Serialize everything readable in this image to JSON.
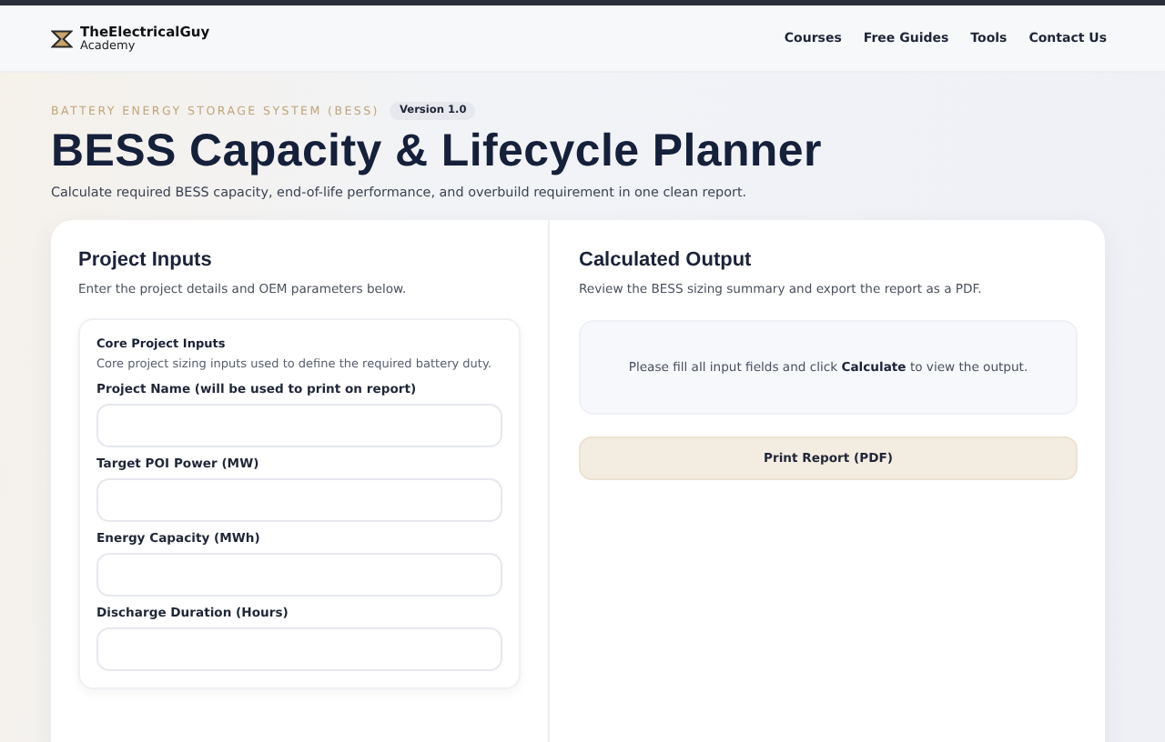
{
  "header": {
    "logo_name": "TheElectricalGuy",
    "logo_sub": "Academy",
    "nav": [
      "Courses",
      "Free Guides",
      "Tools",
      "Contact Us"
    ]
  },
  "hero": {
    "eyebrow": "BATTERY ENERGY STORAGE SYSTEM (BESS)",
    "version": "Version 1.0",
    "title": "BESS Capacity & Lifecycle Planner",
    "subtitle": "Calculate required BESS capacity, end-of-life performance, and overbuild requirement in one clean report."
  },
  "inputs": {
    "title": "Project Inputs",
    "description": "Enter the project details and OEM parameters below.",
    "section_title": "Core Project Inputs",
    "section_description": "Core project sizing inputs used to define the required battery duty.",
    "fields": [
      {
        "label": "Project Name (will be used to print on report)"
      },
      {
        "label": "Target POI Power (MW)"
      },
      {
        "label": "Energy Capacity (MWh)"
      },
      {
        "label": "Discharge Duration (Hours)"
      }
    ]
  },
  "output": {
    "title": "Calculated Output",
    "description": "Review the BESS sizing summary and export the report as a PDF.",
    "message": "Please fill all input fields and click **Calculate** to view the output.",
    "print_button": "Print Report (PDF)"
  }
}
